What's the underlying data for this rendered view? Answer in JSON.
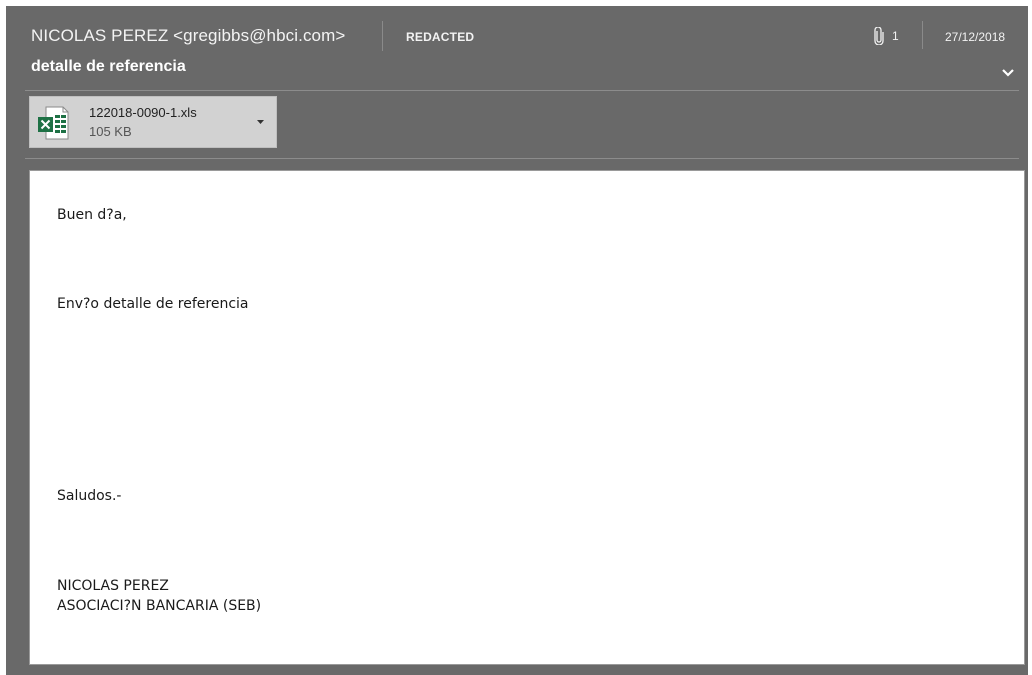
{
  "header": {
    "sender": "NICOLAS PEREZ <gregibbs@hbci.com>",
    "recipient": "REDACTED",
    "attachment_count": "1",
    "date": "27/12/2018",
    "subject": "detalle de referencia"
  },
  "attachment": {
    "filename": "122018-0090-1.xls",
    "size": "105 KB",
    "icon": "excel-file-icon"
  },
  "body": {
    "greeting": "Buen d?a,",
    "message": "Env?o detalle de referencia",
    "closing": "Saludos.-",
    "signature_name": "NICOLAS PEREZ",
    "signature_org": "ASOCIACI?N BANCARIA (SEB)"
  },
  "colors": {
    "header_background": "#696969",
    "header_text": "#f3f3f3",
    "attachment_background": "#d2d2d2",
    "excel_green": "#1e7145",
    "body_background": "#ffffff"
  }
}
